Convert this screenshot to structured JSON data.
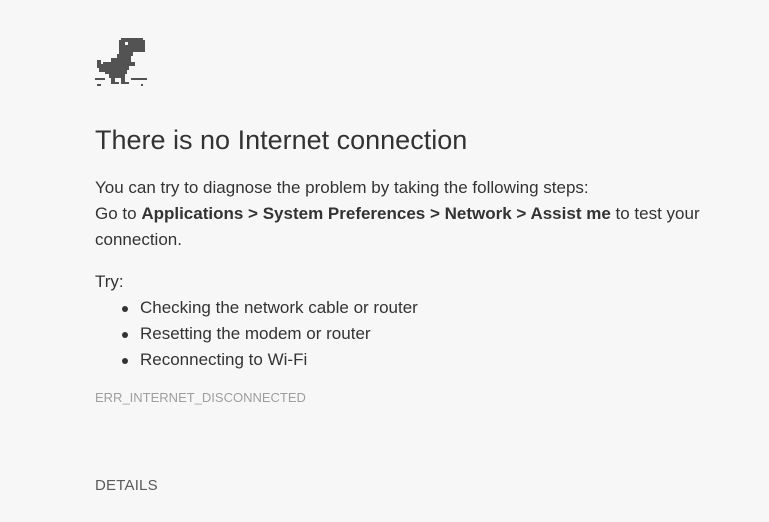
{
  "page": {
    "icon": "offline-dino-icon",
    "title": "There is no Internet connection",
    "description": {
      "line1": "You can try to diagnose the problem by taking the following steps:",
      "line2_prefix": "Go to ",
      "path": [
        "Applications",
        "System Preferences",
        "Network",
        "Assist me"
      ],
      "path_separator": " > ",
      "line2_suffix": " to test your connection."
    },
    "try_label": "Try:",
    "suggestions": [
      "Checking the network cable or router",
      "Resetting the modem or router",
      "Reconnecting to Wi-Fi"
    ],
    "error_code": "ERR_INTERNET_DISCONNECTED",
    "details_label": "DETAILS"
  },
  "colors": {
    "background": "#f7f7f7",
    "text": "#333333",
    "error_code": "#9e9e9e",
    "details": "#5a5a5a"
  }
}
